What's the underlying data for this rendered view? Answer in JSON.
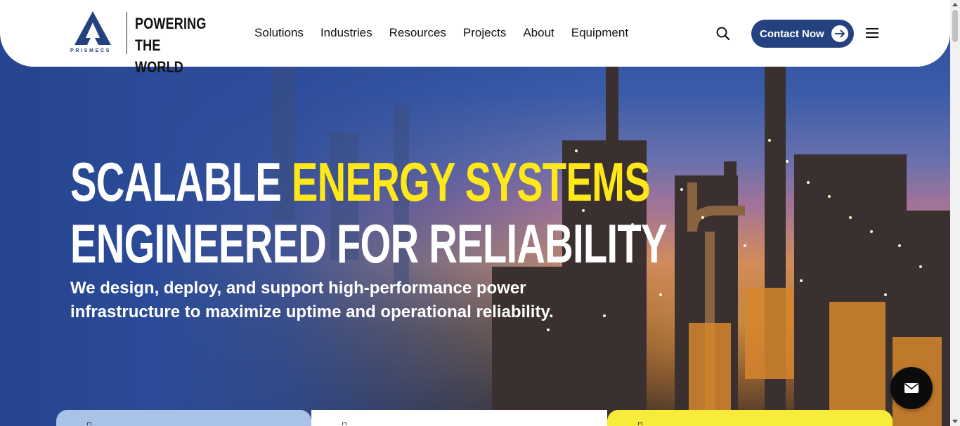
{
  "brand": {
    "logo_text": "PRISMECS",
    "tagline_line1": "POWERING",
    "tagline_line2": "THE WORLD",
    "color": "#24427f"
  },
  "nav": {
    "items": [
      "Solutions",
      "Industries",
      "Resources",
      "Projects",
      "About",
      "Equipment"
    ]
  },
  "header_actions": {
    "search_icon": "search-icon",
    "contact_label": "Contact Now",
    "contact_icon": "arrow-right-circle-icon",
    "menu_icon": "hamburger-menu-icon"
  },
  "hero": {
    "headline_part1": "SCALABLE ",
    "headline_highlight": "ENERGY SYSTEMS",
    "headline_line2": "ENGINEERED FOR RELIABILITY",
    "subtext": "We design, deploy, and support high-performance power infrastructure to maximize uptime and operational reliability.",
    "highlight_color": "#ffe81a"
  },
  "cards": {
    "colors": [
      "#a9c3e8",
      "#ffffff",
      "#f7ec3a"
    ]
  },
  "floating": {
    "mail_icon": "mail-icon"
  }
}
